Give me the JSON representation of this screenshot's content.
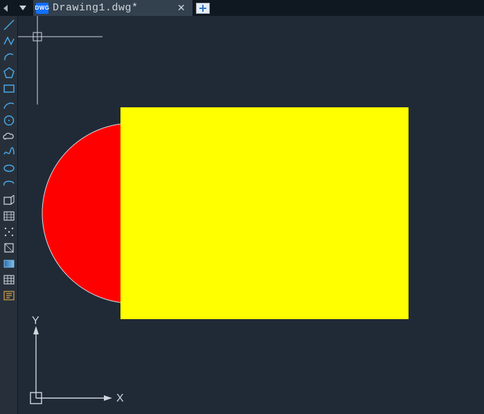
{
  "tabs": {
    "active": {
      "title": "Drawing1.dwg*"
    }
  },
  "axes": {
    "x_label": "X",
    "y_label": "Y"
  },
  "tools": [
    {
      "name": "line",
      "kind": "line"
    },
    {
      "name": "polyline",
      "kind": "polyline"
    },
    {
      "name": "arc",
      "kind": "arc"
    },
    {
      "name": "polygon",
      "kind": "polygon"
    },
    {
      "name": "rectangle",
      "kind": "rect"
    },
    {
      "name": "arc2",
      "kind": "arc2"
    },
    {
      "name": "circle",
      "kind": "circle"
    },
    {
      "name": "cloud",
      "kind": "cloud"
    },
    {
      "name": "spline",
      "kind": "spline"
    },
    {
      "name": "ellipse",
      "kind": "ellipse"
    },
    {
      "name": "ellipse-arc",
      "kind": "ellipsearc"
    },
    {
      "name": "block",
      "kind": "block",
      "cls": "white"
    },
    {
      "name": "hatch",
      "kind": "hatchA",
      "cls": "white"
    },
    {
      "name": "point",
      "kind": "points",
      "cls": "white"
    },
    {
      "name": "region",
      "kind": "square",
      "cls": "white"
    },
    {
      "name": "gradient",
      "kind": "gradient"
    },
    {
      "name": "table",
      "kind": "table",
      "cls": "white"
    },
    {
      "name": "text",
      "kind": "text",
      "cls": "orange"
    }
  ],
  "shapes": {
    "circle": {
      "fill": "#ff0000",
      "stroke": "#d8dde3"
    },
    "rect": {
      "fill": "#ffff00"
    }
  }
}
